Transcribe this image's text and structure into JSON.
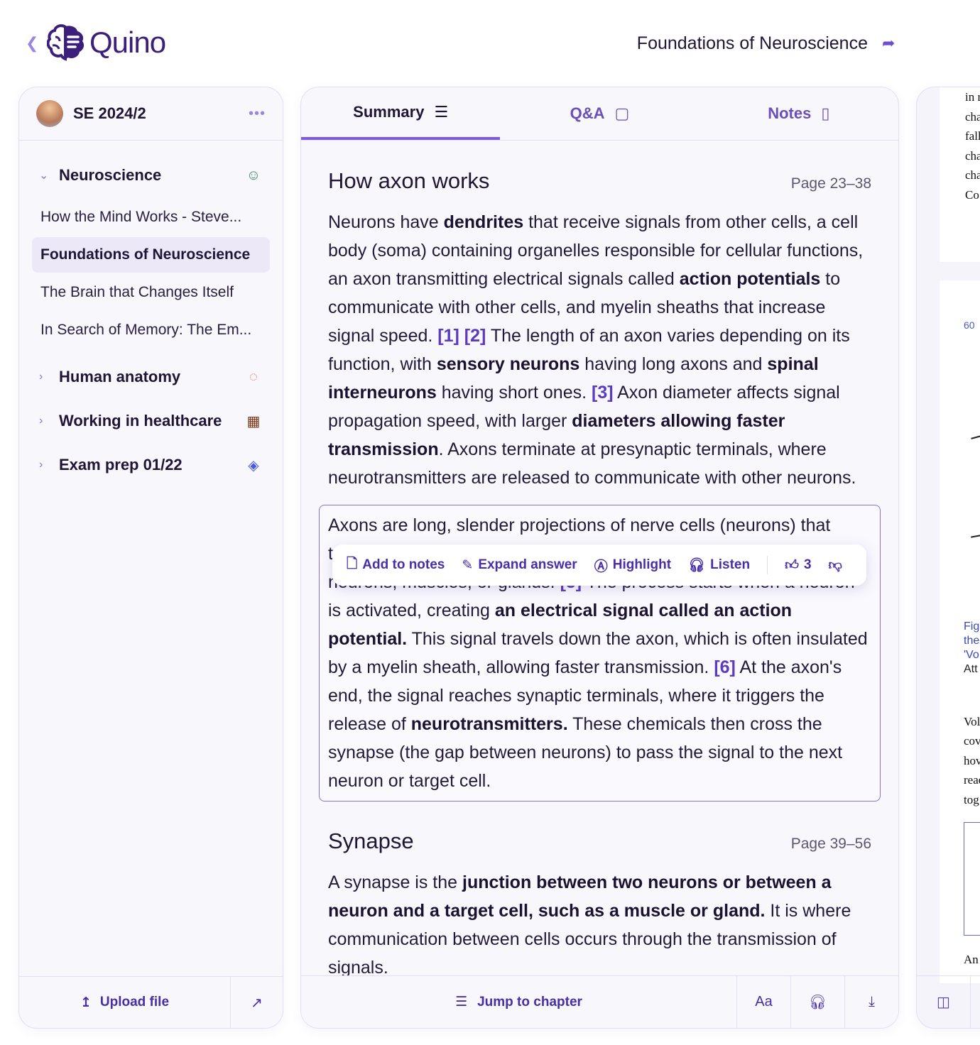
{
  "app": {
    "name": "Quino",
    "doc_title": "Foundations of Neuroscience"
  },
  "sidebar": {
    "workspace": "SE 2024/2",
    "groups": [
      {
        "label": "Neuroscience",
        "expanded": true,
        "icon": "smiling-face-with-halo-icon",
        "color": "#3a8a6a",
        "items": [
          "How the Mind Works - Steve...",
          "Foundations of Neuroscience",
          "The Brain that Changes Itself",
          "In Search of Memory: The Em..."
        ],
        "active": 1
      },
      {
        "label": "Human anatomy",
        "icon": "footprint-icon",
        "color": "#f06060"
      },
      {
        "label": "Working in healthcare",
        "icon": "hospital-icon",
        "color": "#7a3a1a"
      },
      {
        "label": "Exam prep 01/22",
        "icon": "book-icon",
        "color": "#4a5ae0"
      }
    ],
    "upload_label": "Upload file"
  },
  "tabs": [
    {
      "label": "Summary",
      "icon": "list-icon",
      "active": true
    },
    {
      "label": "Q&A",
      "icon": "chat-icon"
    },
    {
      "label": "Notes",
      "icon": "note-icon"
    }
  ],
  "sections": [
    {
      "title": "How axon works",
      "pages": "Page 23–38",
      "para": [
        [
          "Neurons have ",
          0
        ],
        [
          "dendrites",
          1
        ],
        [
          " that receive signals from other cells, a cell body (soma) containing organelles responsible for cellular functions, an axon transmitting electrical signals called ",
          0
        ],
        [
          "action potentials",
          1
        ],
        [
          " to communicate with other cells, and myelin sheaths that increase signal speed. ",
          0
        ],
        [
          "[1] [2]",
          2
        ],
        [
          " The length of an axon varies depending on its function, with ",
          0
        ],
        [
          "sensory neurons",
          1
        ],
        [
          " having long axons and ",
          0
        ],
        [
          "spinal interneurons",
          1
        ],
        [
          " having short ones. ",
          0
        ],
        [
          "[3]",
          2
        ],
        [
          " Axon diameter affects signal propagation speed, with larger ",
          0
        ],
        [
          "diameters allowing faster transmission",
          1
        ],
        [
          ". Axons terminate at presynaptic terminals, where neurotransmitters are released to communicate with other neurons.",
          0
        ]
      ],
      "answer": [
        [
          "Axons are long, slender projections of nerve cells (neurons) that transmit electrical impulses from the neuron's cell body to other neurons, muscles, or glands. ",
          0
        ],
        [
          "[5]",
          2
        ],
        [
          " The process starts when a neuron is activated, creating ",
          0
        ],
        [
          "an electrical signal called an action potential.",
          1
        ],
        [
          " This signal travels down the axon, which is often insulated by a myelin sheath, allowing faster transmission. ",
          0
        ],
        [
          "[6]",
          2
        ],
        [
          " At the axon's end, the signal reaches synaptic terminals, where it triggers the release of ",
          0
        ],
        [
          "neurotransmitters.",
          1
        ],
        [
          " These chemicals then cross the synapse (the gap between neurons) to pass the signal to the next neuron or target cell.",
          0
        ]
      ]
    },
    {
      "title": "Synapse",
      "pages": "Page 39–56",
      "para": [
        [
          "A synapse is the ",
          0
        ],
        [
          "junction between two neurons or between a neuron and a target cell, such as a muscle or gland.",
          1
        ],
        [
          " It is where communication between cells occurs through the transmission of signals.",
          0
        ]
      ]
    }
  ],
  "popup": {
    "add_to_notes": "Add to notes",
    "expand_answer": "Expand answer",
    "highlight": "Highlight",
    "listen": "Listen",
    "likes": "3"
  },
  "footer": {
    "jump_label": "Jump to chapter",
    "font_label": "Aa"
  },
  "preview": {
    "top_lines": [
      "in r",
      "cha",
      "fall",
      "cha",
      "cha",
      "Co"
    ],
    "page_number": "60",
    "caption_lines": [
      "Fig",
      "the",
      "'Vo",
      "Att"
    ],
    "body_lines": [
      "Vol",
      "cov",
      "hov",
      "read",
      "tog"
    ],
    "bottom_line": "An"
  }
}
